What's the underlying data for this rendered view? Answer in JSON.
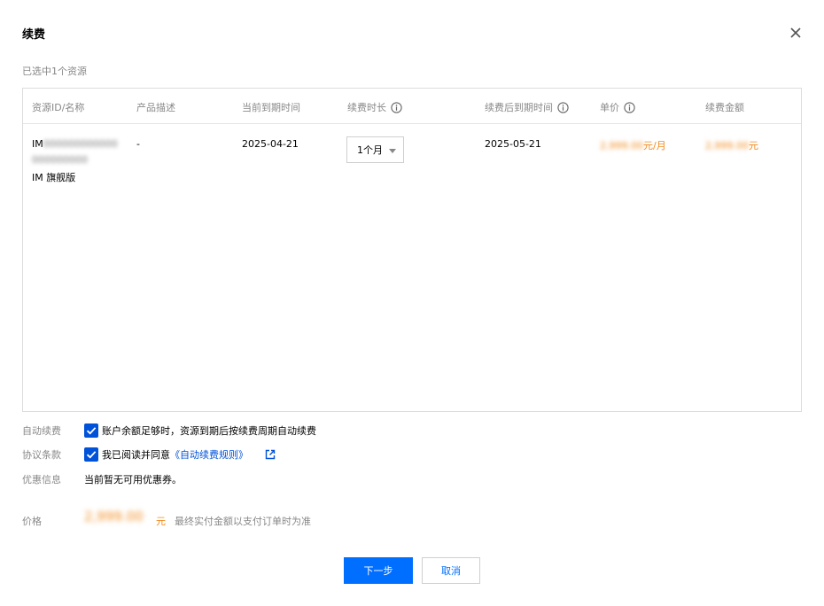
{
  "dialog": {
    "title": "续费",
    "close_label": "×",
    "selected_note": "已选中1个资源"
  },
  "table": {
    "headers": [
      {
        "label": "资源ID/名称",
        "info": false
      },
      {
        "label": "产品描述",
        "info": false
      },
      {
        "label": "当前到期时间",
        "info": false
      },
      {
        "label": "续费时长",
        "info": true
      },
      {
        "label": "续费后到期时间",
        "info": true
      },
      {
        "label": "单价",
        "info": true
      },
      {
        "label": "续费金额",
        "info": false
      }
    ],
    "rows": [
      {
        "id_prefix": "IM",
        "id_masked_1": "000000000000",
        "id_masked_2": "000000000",
        "name": "IM 旗舰版",
        "desc": "-",
        "current_expiry": "2025-04-21",
        "duration": "1个月",
        "new_expiry": "2025-05-21",
        "unit_price_masked": "2,999.00",
        "unit_price_suffix": "元/月",
        "amount_masked": "2,999.00",
        "amount_suffix": "元"
      }
    ]
  },
  "auto_renew": {
    "label": "自动续费",
    "checked": true,
    "text": "账户余额足够时，资源到期后按续费周期自动续费"
  },
  "agreement": {
    "label": "协议条款",
    "checked": true,
    "text_prefix": "我已阅读并同意",
    "link_text": "《自动续费规则》"
  },
  "coupon": {
    "label": "优惠信息",
    "text": "当前暂无可用优惠券。"
  },
  "price": {
    "label": "价格",
    "value_masked": "2,999.00",
    "unit": "元",
    "note": "最终实付金额以支付订单时为准"
  },
  "buttons": {
    "next": "下一步",
    "cancel": "取消"
  },
  "colors": {
    "primary": "#006eff",
    "link": "#0052d9",
    "price": "#f08a1c",
    "muted": "#888888"
  }
}
